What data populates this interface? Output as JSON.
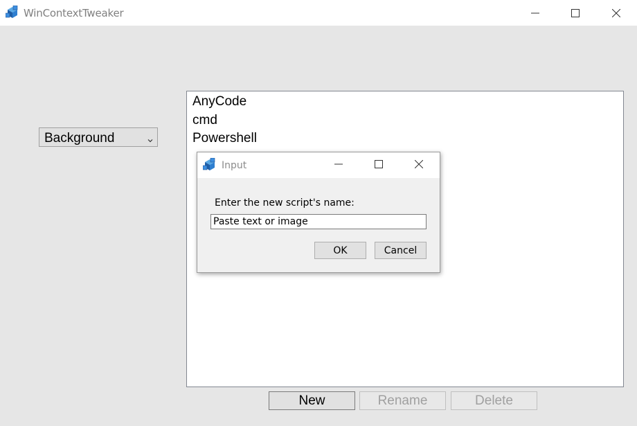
{
  "window": {
    "title": "WinContextTweaker",
    "icon": "app-cube-icon",
    "controls": [
      "minimize-icon",
      "maximize-icon",
      "close-icon"
    ]
  },
  "combo": {
    "selected": "Background"
  },
  "list": {
    "items": [
      "AnyCode",
      "cmd",
      "Powershell"
    ]
  },
  "buttons": {
    "new_label": "New",
    "rename_label": "Rename",
    "delete_label": "Delete"
  },
  "dialog": {
    "title": "Input",
    "prompt": "Enter the new script's name:",
    "input_value": "Paste text or image",
    "ok_label": "OK",
    "cancel_label": "Cancel"
  },
  "colors": {
    "background": "#e6e6e6",
    "titlebar": "#ffffff",
    "icon_blue": "#2b6cb0",
    "disabled_text": "#a0a0a0"
  }
}
